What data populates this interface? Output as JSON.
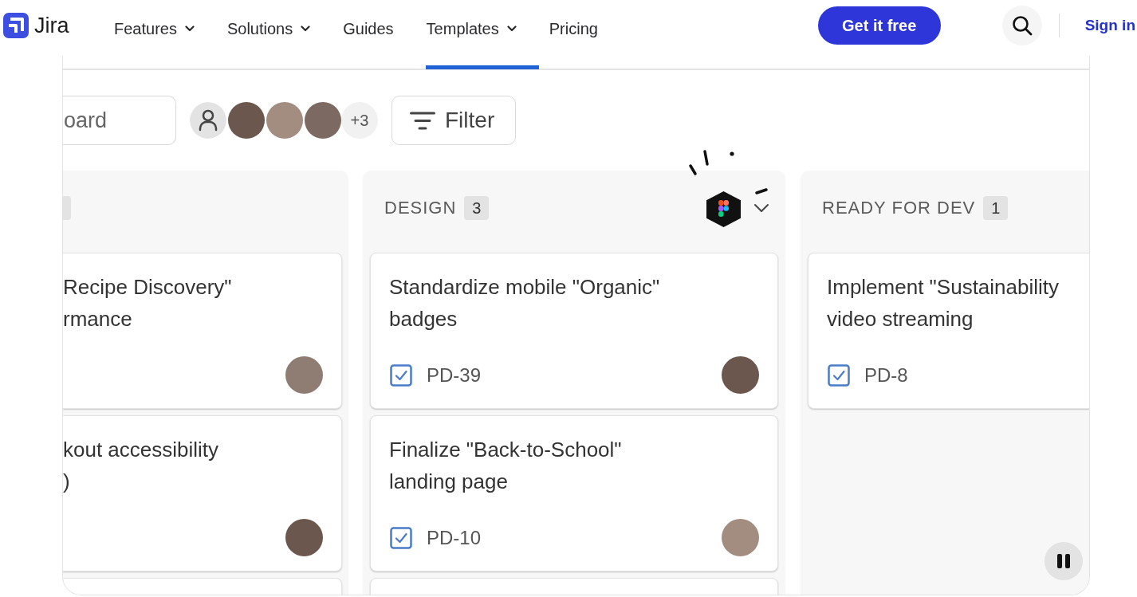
{
  "nav": {
    "logo": "Jira",
    "items": [
      {
        "label": "Features",
        "has_menu": true
      },
      {
        "label": "Solutions",
        "has_menu": true
      },
      {
        "label": "Guides",
        "has_menu": false
      },
      {
        "label": "Templates",
        "has_menu": true
      },
      {
        "label": "Pricing",
        "has_menu": false
      }
    ],
    "cta": "Get it free",
    "sign_in": "Sign in"
  },
  "board": {
    "search": {
      "placeholder": "oard"
    },
    "people": [
      {
        "kind": "unassigned"
      },
      {
        "kind": "photo"
      },
      {
        "kind": "photo"
      },
      {
        "kind": "photo"
      },
      {
        "kind": "more",
        "label": "+3"
      }
    ],
    "filter": "Filter",
    "columns": [
      {
        "header_cut": true,
        "cards": [
          {
            "title": "Recipe Discovery\"\nrmance",
            "has_avatar": true
          },
          {
            "title": "kout accessibility\n)",
            "has_avatar": true
          }
        ],
        "more_below": true
      },
      {
        "title": "DESIGN",
        "count": "3",
        "app_icon": true,
        "menu": true,
        "cards": [
          {
            "title": "Standardize mobile \"Organic\"\nbadges",
            "kind": "task",
            "key": "PD-39",
            "has_avatar": true
          },
          {
            "title": "Finalize \"Back-to-School\"\nlanding page",
            "kind": "task",
            "key": "PD-10",
            "has_avatar": true
          }
        ],
        "more_below": true
      },
      {
        "title": "READY FOR DEV",
        "count": "1",
        "cards": [
          {
            "title": "Implement \"Sustainability\nvideo streaming",
            "kind": "task",
            "key": "PD-8",
            "has_avatar": false
          }
        ]
      }
    ],
    "playback": {
      "playing": true
    }
  }
}
